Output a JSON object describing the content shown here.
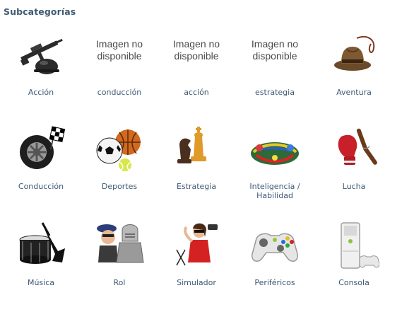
{
  "header": {
    "title": "Subcategorías"
  },
  "no_image_text": "Imagen no disponible",
  "categories": [
    {
      "label": "Acción",
      "icon": "assault-rifle-helmet-icon"
    },
    {
      "label": "conducción",
      "icon": "no-image-placeholder"
    },
    {
      "label": "acción",
      "icon": "no-image-placeholder"
    },
    {
      "label": "estrategia",
      "icon": "no-image-placeholder"
    },
    {
      "label": "Aventura",
      "icon": "fedora-whip-icon"
    },
    {
      "label": "Conducción",
      "icon": "tire-checkered-flag-icon"
    },
    {
      "label": "Deportes",
      "icon": "sports-balls-icon"
    },
    {
      "label": "Estrategia",
      "icon": "chess-pieces-icon"
    },
    {
      "label": "Inteligencia / Habilidad",
      "icon": "board-game-icon"
    },
    {
      "label": "Lucha",
      "icon": "boxing-glove-nunchaku-icon"
    },
    {
      "label": "Música",
      "icon": "drum-guitar-icon"
    },
    {
      "label": "Rol",
      "icon": "knight-helmet-character-icon"
    },
    {
      "label": "Simulador",
      "icon": "woman-sunglasses-icon"
    },
    {
      "label": "Periféricos",
      "icon": "game-controller-icon"
    },
    {
      "label": "Consola",
      "icon": "game-console-icon"
    }
  ]
}
